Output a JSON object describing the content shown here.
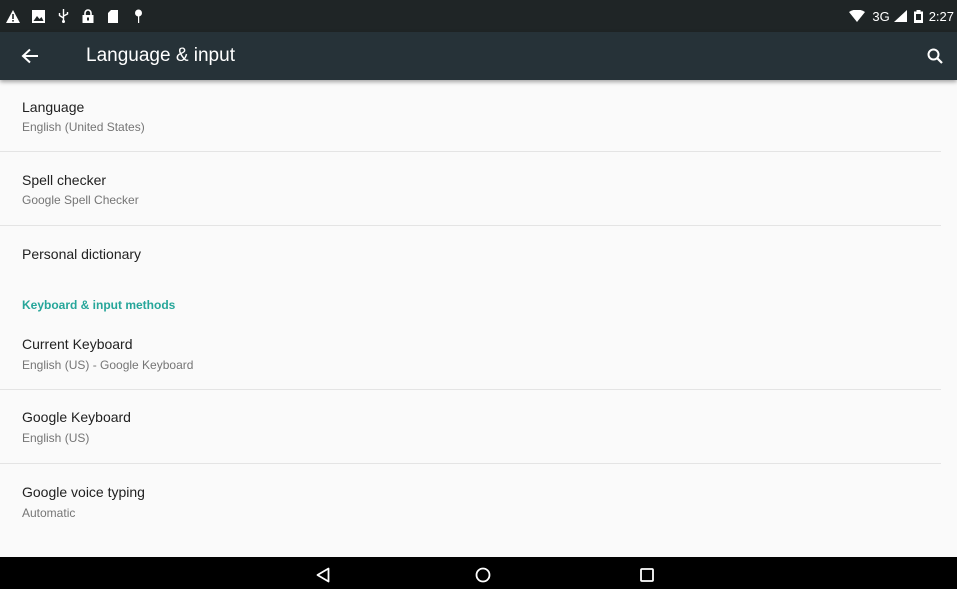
{
  "status_bar": {
    "left_icons": [
      "warning-icon",
      "image-icon",
      "usb-icon",
      "lock-icon",
      "sd-card-icon",
      "pin-icon"
    ],
    "network": "3G",
    "time": "2:27"
  },
  "toolbar": {
    "title": "Language & input",
    "back_icon": "arrow-back-icon",
    "search_icon": "search-icon",
    "color": "#263238"
  },
  "preferences": [
    {
      "title": "Language",
      "summary": "English (United States)"
    },
    {
      "title": "Spell checker",
      "summary": "Google Spell Checker"
    },
    {
      "title": "Personal dictionary"
    }
  ],
  "category": {
    "label": "Keyboard & input methods",
    "color": "#26a69a"
  },
  "keyboard_preferences": [
    {
      "title": "Current Keyboard",
      "summary": "English (US) - Google Keyboard"
    },
    {
      "title": "Google Keyboard",
      "summary": "English (US)"
    },
    {
      "title": "Google voice typing",
      "summary": "Automatic"
    }
  ],
  "nav_bar": {
    "buttons": [
      "back-triangle-icon",
      "home-circle-icon",
      "recents-square-icon"
    ]
  }
}
